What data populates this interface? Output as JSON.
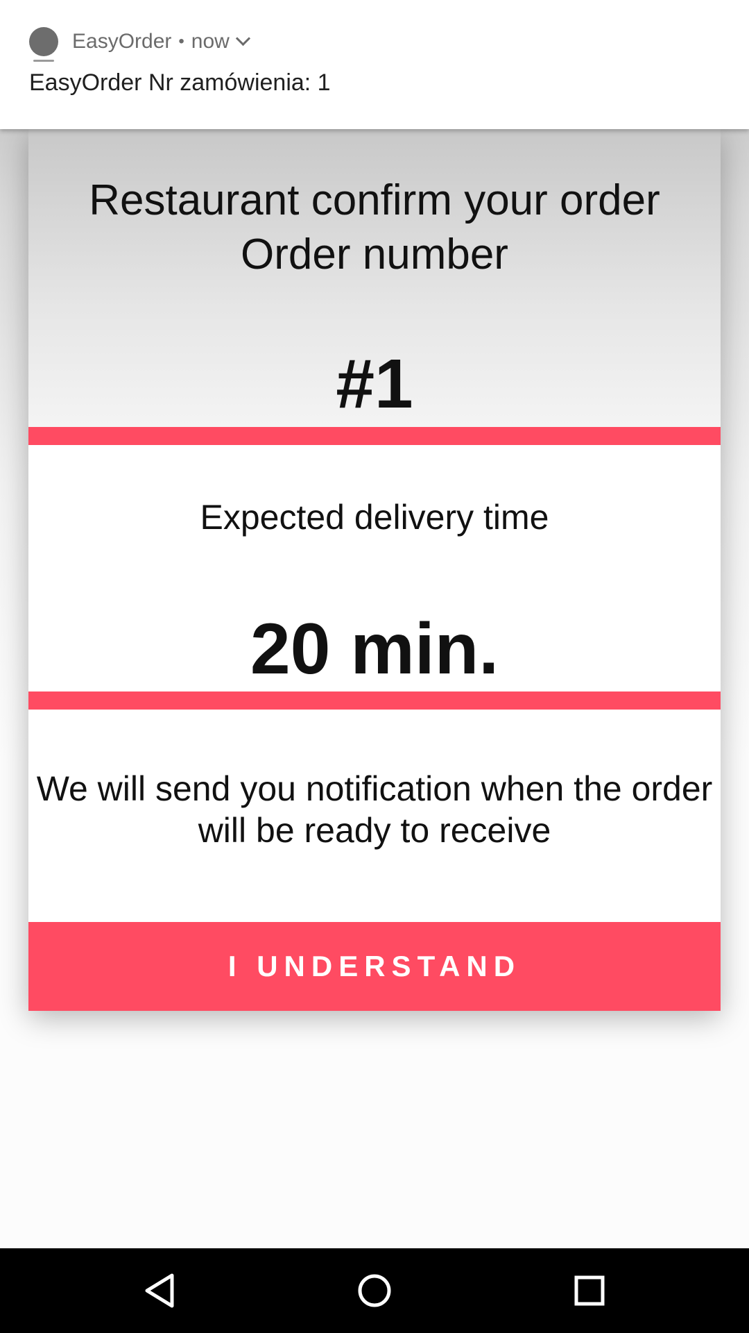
{
  "notification": {
    "app_name": "EasyOrder",
    "separator": "•",
    "time": "now",
    "text": "EasyOrder Nr zamówienia: 1"
  },
  "dialog": {
    "title_line1": "Restaurant confirm your order",
    "title_line2": "Order number",
    "order_number": "#1",
    "delivery_label": "Expected delivery time",
    "delivery_time": "20 min.",
    "info_line1": "We will send you notification when the order",
    "info_line2": "will be ready to receive",
    "button_label": "I UNDERSTAND"
  },
  "navbar": {
    "icons": [
      "back-icon",
      "home-icon",
      "recent-apps-icon"
    ]
  },
  "colors": {
    "accent": "#ff4b62",
    "notification_bg": "#ffffff",
    "navbar_bg": "#000000"
  }
}
